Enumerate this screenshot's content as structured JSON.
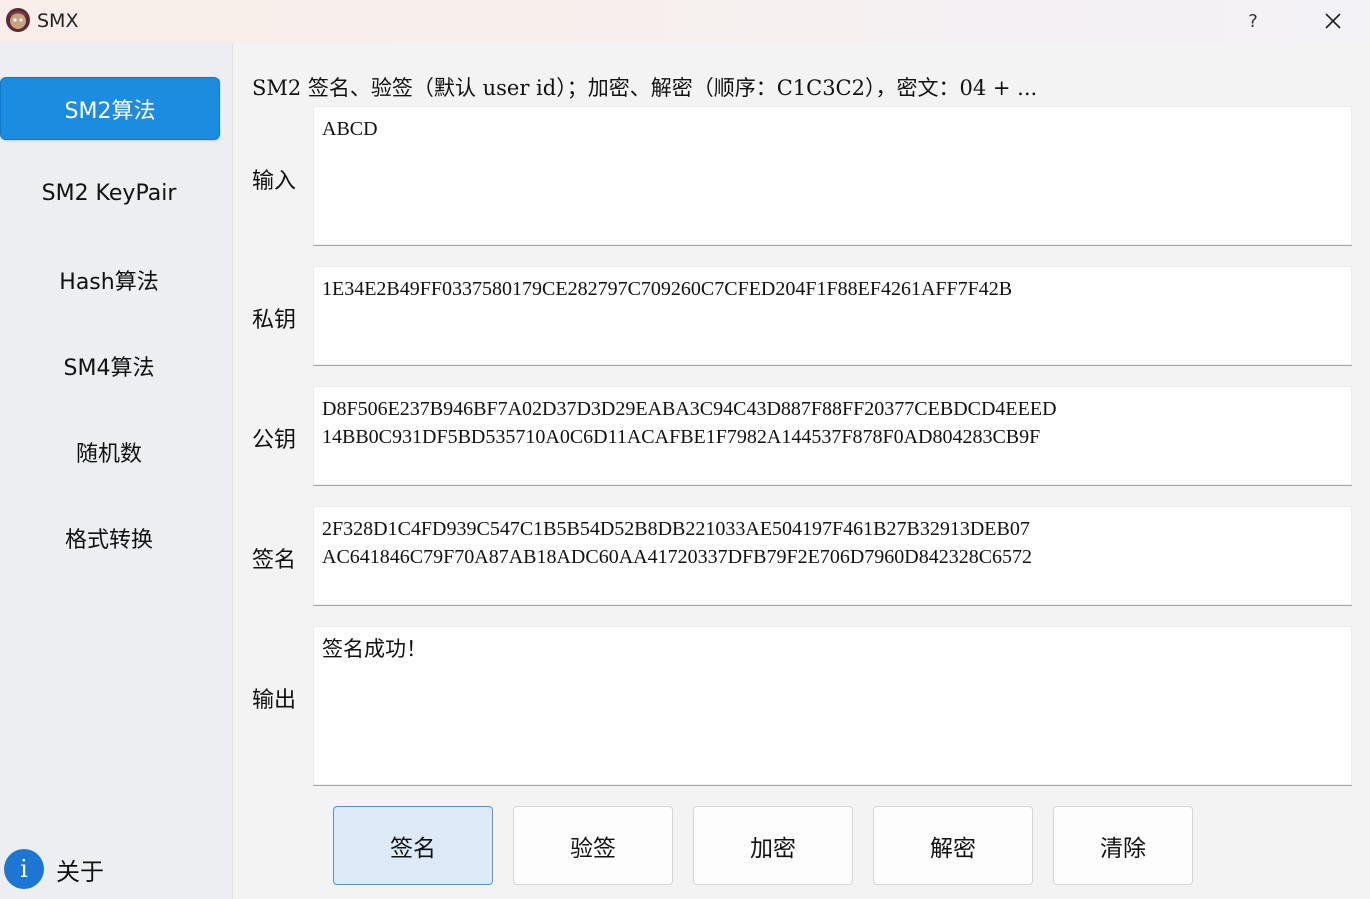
{
  "window": {
    "title": "SMX",
    "help_label": "?"
  },
  "sidebar": {
    "items": [
      {
        "label": "SM2算法",
        "active": true
      },
      {
        "label": "SM2 KeyPair"
      },
      {
        "label": "Hash算法"
      },
      {
        "label": "SM4算法"
      },
      {
        "label": "随机数"
      },
      {
        "label": "格式转换"
      }
    ],
    "about": {
      "icon": "info-icon",
      "icon_glyph": "i",
      "label": "关于"
    }
  },
  "main": {
    "description": "SM2 签名、验签（默认 user id）；加密、解密（顺序：C1C3C2），密文：04 + ...",
    "fields": {
      "input": {
        "label": "输入",
        "value": "ABCD"
      },
      "private_key": {
        "label": "私钥",
        "value": "1E34E2B49FF0337580179CE282797C709260C7CFED204F1F88EF4261AFF7F42B"
      },
      "public_key": {
        "label": "公钥",
        "value": "D8F506E237B946BF7A02D37D3D29EABA3C94C43D887F88FF20377CEBDCD4EEED\n14BB0C931DF5BD535710A0C6D11ACAFBE1F7982A144537F878F0AD804283CB9F"
      },
      "signature": {
        "label": "签名",
        "value": "2F328D1C4FD939C547C1B5B54D52B8DB221033AE504197F461B27B32913DEB07\nAC641846C79F70A87AB18ADC60AA41720337DFB79F2E706D7960D842328C6572"
      },
      "output": {
        "label": "输出",
        "value": "签名成功！"
      }
    },
    "buttons": {
      "sign": "签名",
      "verify": "验签",
      "encrypt": "加密",
      "decrypt": "解密",
      "clear": "清除"
    }
  },
  "colors": {
    "accent": "#1b8ce0",
    "primary_button_bg": "#dde9f6",
    "sidebar_bg": "#edeef2",
    "window_bg": "#f3f3f3"
  }
}
